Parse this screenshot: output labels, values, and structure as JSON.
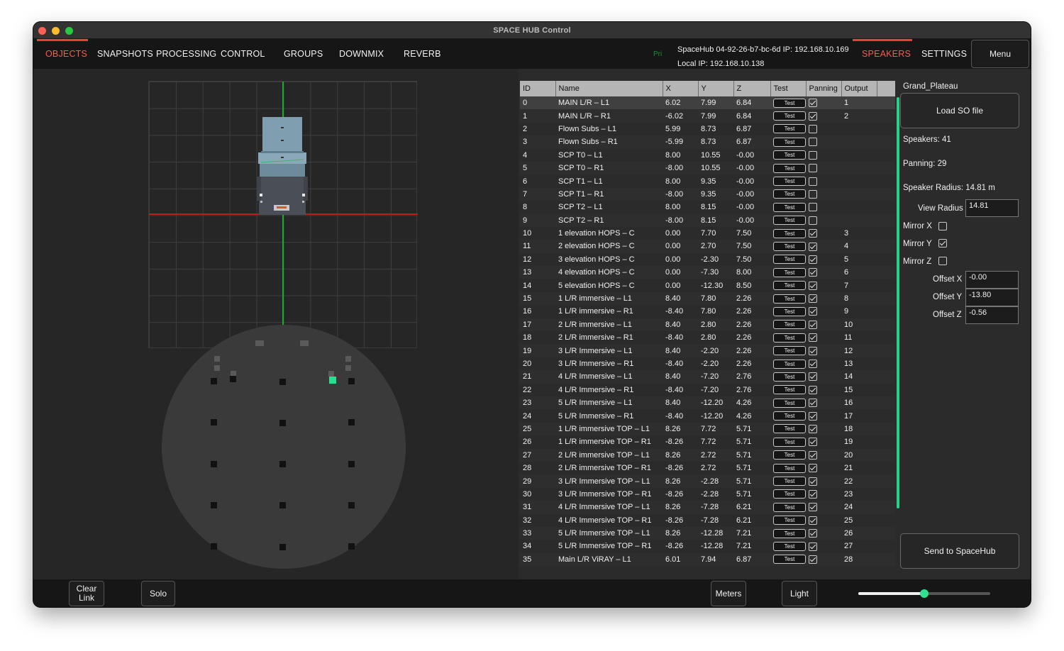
{
  "window": {
    "title": "SPACE HUB Control"
  },
  "tabs_left": [
    {
      "label": "OBJECTS",
      "active": true
    },
    {
      "label": "SNAPSHOTS",
      "active": false
    },
    {
      "label": "PROCESSING",
      "active": false
    },
    {
      "label": "CONTROL",
      "active": false
    },
    {
      "label": "GROUPS",
      "active": false
    },
    {
      "label": "DOWNMIX",
      "active": false
    },
    {
      "label": "REVERB",
      "active": false
    }
  ],
  "status": {
    "pri": "Pri",
    "device_line": "SpaceHub 04-92-26-b7-bc-6d IP: 192.168.10.169",
    "local_line": "Local IP: 192.168.10.138"
  },
  "tabs_right": [
    {
      "label": "SPEAKERS",
      "active": true
    },
    {
      "label": "SETTINGS",
      "active": false
    }
  ],
  "menu_label": "Menu",
  "table": {
    "columns": [
      "ID",
      "Name",
      "X",
      "Y",
      "Z",
      "Test",
      "Panning",
      "Output"
    ],
    "test_label": "Test",
    "rows": [
      {
        "id": "0",
        "name": "MAIN L/R – L1",
        "x": "6.02",
        "y": "7.99",
        "z": "6.84",
        "pan": true,
        "out": "1"
      },
      {
        "id": "1",
        "name": "MAIN L/R – R1",
        "x": "-6.02",
        "y": "7.99",
        "z": "6.84",
        "pan": true,
        "out": "2"
      },
      {
        "id": "2",
        "name": "Flown Subs – L1",
        "x": "5.99",
        "y": "8.73",
        "z": "6.87",
        "pan": false,
        "out": ""
      },
      {
        "id": "3",
        "name": "Flown Subs – R1",
        "x": "-5.99",
        "y": "8.73",
        "z": "6.87",
        "pan": false,
        "out": ""
      },
      {
        "id": "4",
        "name": "SCP T0 – L1",
        "x": "8.00",
        "y": "10.55",
        "z": "-0.00",
        "pan": false,
        "out": ""
      },
      {
        "id": "5",
        "name": "SCP T0 – R1",
        "x": "-8.00",
        "y": "10.55",
        "z": "-0.00",
        "pan": false,
        "out": ""
      },
      {
        "id": "6",
        "name": "SCP T1 – L1",
        "x": "8.00",
        "y": "9.35",
        "z": "-0.00",
        "pan": false,
        "out": ""
      },
      {
        "id": "7",
        "name": "SCP T1 – R1",
        "x": "-8.00",
        "y": "9.35",
        "z": "-0.00",
        "pan": false,
        "out": ""
      },
      {
        "id": "8",
        "name": "SCP T2 – L1",
        "x": "8.00",
        "y": "8.15",
        "z": "-0.00",
        "pan": false,
        "out": ""
      },
      {
        "id": "9",
        "name": "SCP T2 – R1",
        "x": "-8.00",
        "y": "8.15",
        "z": "-0.00",
        "pan": false,
        "out": ""
      },
      {
        "id": "10",
        "name": "1 elevation HOPS – C",
        "x": "0.00",
        "y": "7.70",
        "z": "7.50",
        "pan": true,
        "out": "3"
      },
      {
        "id": "11",
        "name": "2 elevation HOPS – C",
        "x": "0.00",
        "y": "2.70",
        "z": "7.50",
        "pan": true,
        "out": "4"
      },
      {
        "id": "12",
        "name": "3 elevation HOPS – C",
        "x": "0.00",
        "y": "-2.30",
        "z": "7.50",
        "pan": true,
        "out": "5"
      },
      {
        "id": "13",
        "name": "4 elevation HOPS – C",
        "x": "0.00",
        "y": "-7.30",
        "z": "8.00",
        "pan": true,
        "out": "6"
      },
      {
        "id": "14",
        "name": "5 elevation HOPS – C",
        "x": "0.00",
        "y": "-12.30",
        "z": "8.50",
        "pan": true,
        "out": "7"
      },
      {
        "id": "15",
        "name": "1 L/R immersive  – L1",
        "x": "8.40",
        "y": "7.80",
        "z": "2.26",
        "pan": true,
        "out": "8"
      },
      {
        "id": "16",
        "name": "1 L/R immersive  – R1",
        "x": "-8.40",
        "y": "7.80",
        "z": "2.26",
        "pan": true,
        "out": "9"
      },
      {
        "id": "17",
        "name": "2 L/R immersive – L1",
        "x": "8.40",
        "y": "2.80",
        "z": "2.26",
        "pan": true,
        "out": "10"
      },
      {
        "id": "18",
        "name": "2 L/R immersive – R1",
        "x": "-8.40",
        "y": "2.80",
        "z": "2.26",
        "pan": true,
        "out": "11"
      },
      {
        "id": "19",
        "name": "3 L/R Immersive – L1",
        "x": "8.40",
        "y": "-2.20",
        "z": "2.26",
        "pan": true,
        "out": "12"
      },
      {
        "id": "20",
        "name": "3 L/R Immersive – R1",
        "x": "-8.40",
        "y": "-2.20",
        "z": "2.26",
        "pan": true,
        "out": "13"
      },
      {
        "id": "21",
        "name": "4 L/R Immersive – L1",
        "x": "8.40",
        "y": "-7.20",
        "z": "2.76",
        "pan": true,
        "out": "14"
      },
      {
        "id": "22",
        "name": "4 L/R Immersive – R1",
        "x": "-8.40",
        "y": "-7.20",
        "z": "2.76",
        "pan": true,
        "out": "15"
      },
      {
        "id": "23",
        "name": "5 L/R Immersive – L1",
        "x": "8.40",
        "y": "-12.20",
        "z": "4.26",
        "pan": true,
        "out": "16"
      },
      {
        "id": "24",
        "name": "5 L/R Immersive – R1",
        "x": "-8.40",
        "y": "-12.20",
        "z": "4.26",
        "pan": true,
        "out": "17"
      },
      {
        "id": "25",
        "name": "1 L/R immersive TOP – L1",
        "x": "8.26",
        "y": "7.72",
        "z": "5.71",
        "pan": true,
        "out": "18"
      },
      {
        "id": "26",
        "name": "1 L/R immersive TOP – R1",
        "x": "-8.26",
        "y": "7.72",
        "z": "5.71",
        "pan": true,
        "out": "19"
      },
      {
        "id": "27",
        "name": "2 L/R immersive TOP – L1",
        "x": "8.26",
        "y": "2.72",
        "z": "5.71",
        "pan": true,
        "out": "20"
      },
      {
        "id": "28",
        "name": "2 L/R immersive TOP – R1",
        "x": "-8.26",
        "y": "2.72",
        "z": "5.71",
        "pan": true,
        "out": "21"
      },
      {
        "id": "29",
        "name": "3 L/R Immersive TOP – L1",
        "x": "8.26",
        "y": "-2.28",
        "z": "5.71",
        "pan": true,
        "out": "22"
      },
      {
        "id": "30",
        "name": "3 L/R Immersive TOP – R1",
        "x": "-8.26",
        "y": "-2.28",
        "z": "5.71",
        "pan": true,
        "out": "23"
      },
      {
        "id": "31",
        "name": "4 L/R Immersive TOP – L1",
        "x": "8.26",
        "y": "-7.28",
        "z": "6.21",
        "pan": true,
        "out": "24"
      },
      {
        "id": "32",
        "name": "4 L/R Immersive TOP – R1",
        "x": "-8.26",
        "y": "-7.28",
        "z": "6.21",
        "pan": true,
        "out": "25"
      },
      {
        "id": "33",
        "name": "5 L/R Immersive TOP – L1",
        "x": "8.26",
        "y": "-12.28",
        "z": "7.21",
        "pan": true,
        "out": "26"
      },
      {
        "id": "34",
        "name": "5 L/R Immersive TOP – R1",
        "x": "-8.26",
        "y": "-12.28",
        "z": "7.21",
        "pan": true,
        "out": "27"
      },
      {
        "id": "35",
        "name": "Main L/R  ViRAY – L1",
        "x": "6.01",
        "y": "7.94",
        "z": "6.87",
        "pan": true,
        "out": "28"
      }
    ]
  },
  "right_panel": {
    "file_name": "Grand_Plateau",
    "load_button": "Load SO file",
    "speakers": "Speakers: 41",
    "panning": "Panning: 29",
    "speaker_radius": "Speaker Radius: 14.81 m",
    "view_radius_label": "View Radius",
    "view_radius_value": "14.81",
    "mirror_x_label": "Mirror X",
    "mirror_x": false,
    "mirror_y_label": "Mirror Y",
    "mirror_y": true,
    "mirror_z_label": "Mirror Z",
    "mirror_z": false,
    "offset_x_label": "Offset X",
    "offset_x": "-0.00",
    "offset_y_label": "Offset Y",
    "offset_y": "-13.80",
    "offset_z_label": "Offset Z",
    "offset_z": "-0.56",
    "send_button": "Send to SpaceHub"
  },
  "bottom": {
    "clear_link": "Clear\nLink",
    "solo": "Solo",
    "meters": "Meters",
    "light": "Light",
    "slider_value": 0.5
  },
  "colors": {
    "accent_red": "#ff5a4e",
    "accent_green": "#27e08e",
    "axis_green": "#1faa2c",
    "axis_red": "#c21a1a"
  }
}
